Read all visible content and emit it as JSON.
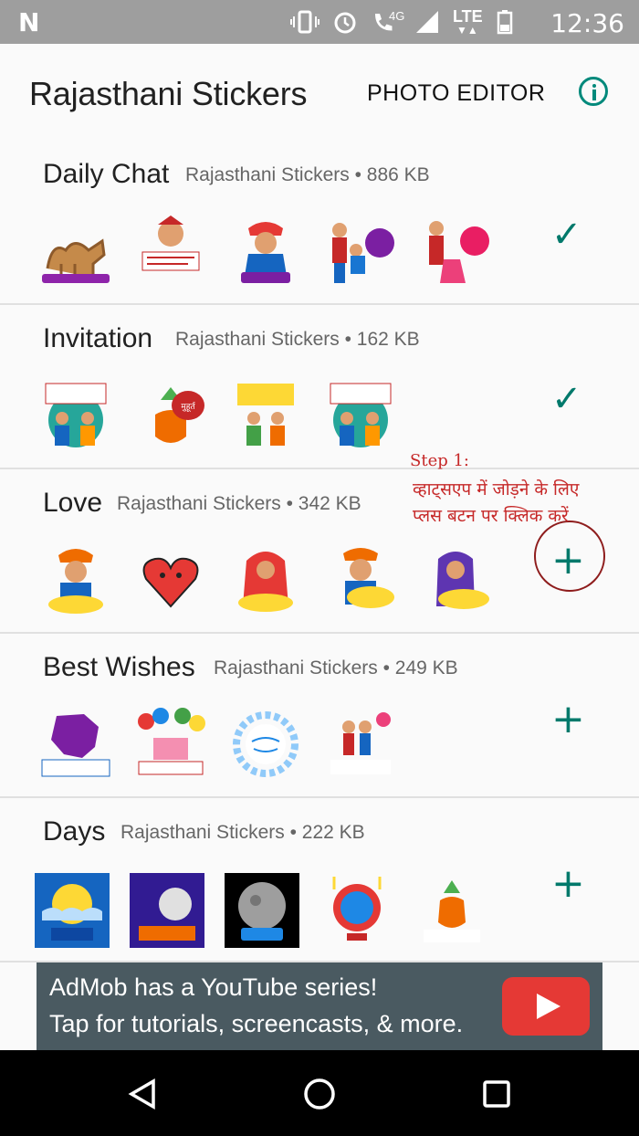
{
  "status": {
    "time": "12:36",
    "network": "4G",
    "lte": "LTE"
  },
  "appbar": {
    "title": "Rajasthani Stickers",
    "photo_editor": "PHOTO EDITOR"
  },
  "packs": [
    {
      "name": "Daily Chat",
      "meta": "Rajasthani Stickers • 886 KB",
      "state": "added"
    },
    {
      "name": "Invitation",
      "meta": "Rajasthani Stickers • 162 KB",
      "state": "added"
    },
    {
      "name": "Love",
      "meta": "Rajasthani Stickers • 342 KB",
      "state": "add"
    },
    {
      "name": "Best Wishes",
      "meta": "Rajasthani Stickers • 249 KB",
      "state": "add"
    },
    {
      "name": "Days",
      "meta": "Rajasthani Stickers • 222 KB",
      "state": "add"
    }
  ],
  "annotation": {
    "step": "Step 1:",
    "line1": "व्हाट्सएप में जोड़ने के लिए",
    "line2": "प्लस बटन पर क्लिक करें"
  },
  "ad": {
    "line1": "AdMob has a YouTube series!",
    "line2": "Tap for tutorials, screencasts, & more."
  },
  "colors": {
    "accent": "#00796b",
    "annotation": "#c62828",
    "ad_bg": "#4a5a61"
  }
}
